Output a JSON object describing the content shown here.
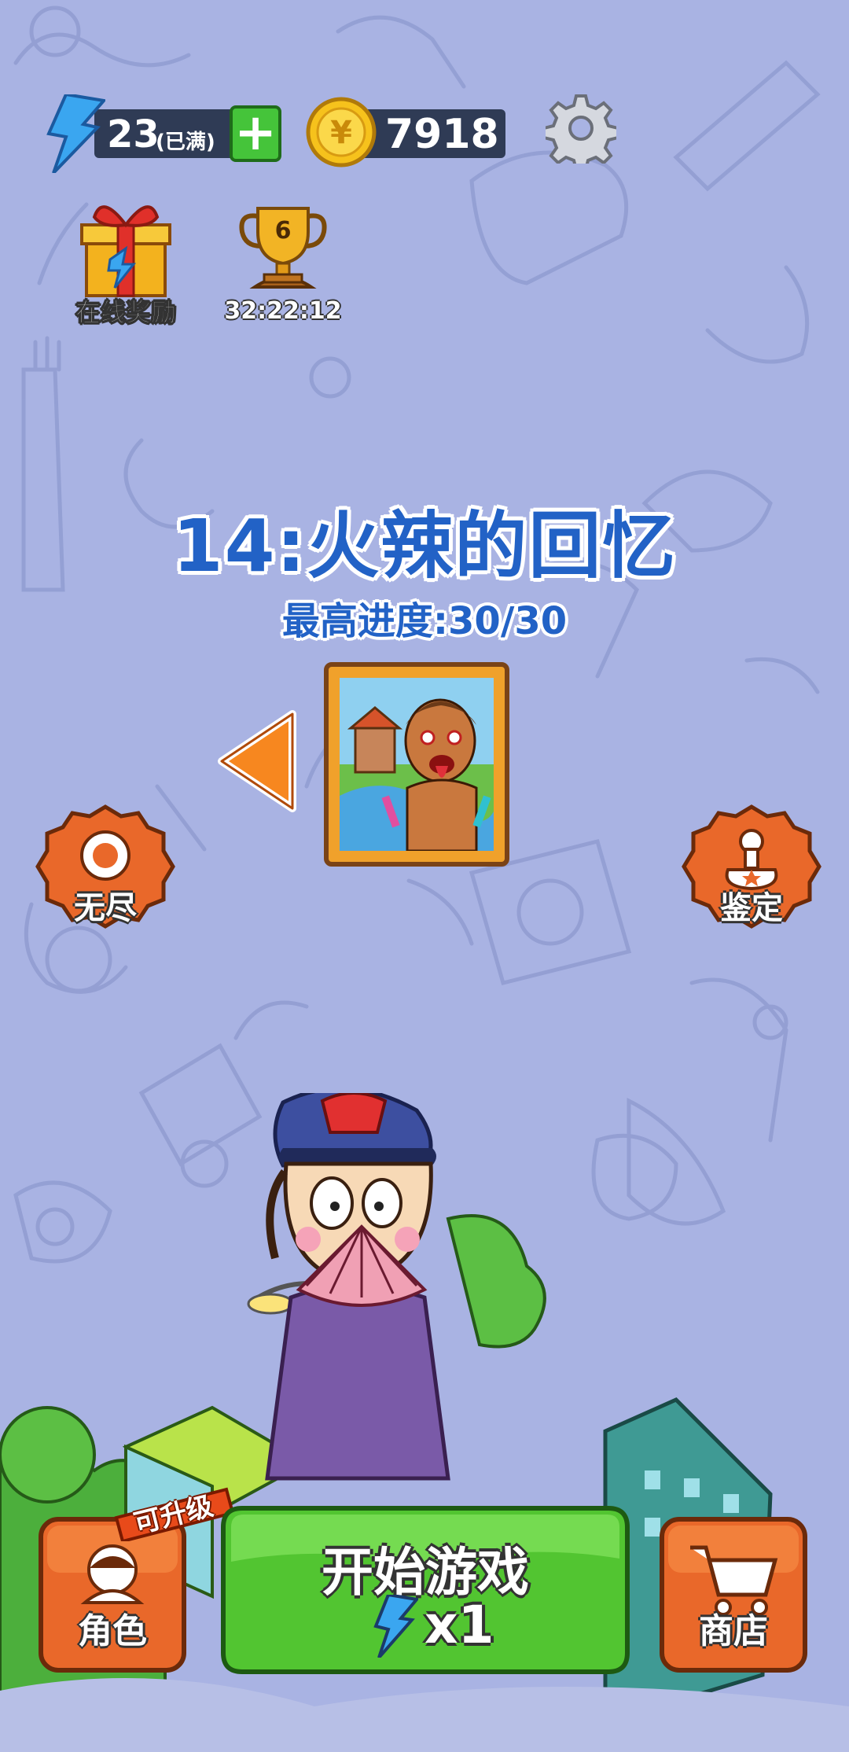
{
  "top_bar": {
    "energy_value": "23",
    "energy_note": "(已满)",
    "coin_value": "7918",
    "coin_symbol": "¥"
  },
  "rewards": {
    "online_reward_label": "在线奖励",
    "trophy_rank": "6",
    "trophy_timer": "32:22:12"
  },
  "level": {
    "title": "14:火辣的回忆",
    "progress_text": "最高进度:30/30"
  },
  "side_buttons": {
    "endless_label": "无尽",
    "appraise_label": "鉴定"
  },
  "bottom_bar": {
    "role_label": "角色",
    "upgrade_tag": "可升级",
    "start_label": "开始游戏",
    "start_cost": "x1",
    "shop_label": "商店"
  },
  "colors": {
    "background": "#a9b3e3",
    "title_blue": "#2262c6",
    "button_orange": "#e9682a",
    "button_green": "#52c531"
  }
}
